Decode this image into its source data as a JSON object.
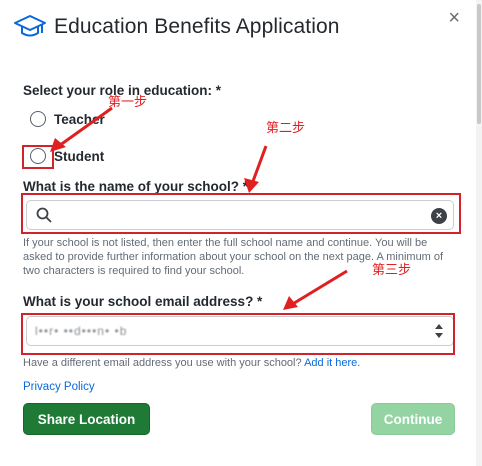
{
  "dialog": {
    "title": "Education Benefits Application",
    "close_glyph": "×",
    "icon": "graduation-cap-icon"
  },
  "role": {
    "label": "Select your role in education: *",
    "options": [
      "Teacher",
      "Student"
    ]
  },
  "school": {
    "label": "What is the name of your school? *",
    "value": "",
    "help": "If your school is not listed, then enter the full school name and continue. You will be asked to provide further information about your school on the next page. A minimum of two characters is required to find your school."
  },
  "email": {
    "label": "What is your school email address? *",
    "value": "l••r• ••d•••n• •b",
    "help_prefix": "Have a different email address you use with your school?",
    "help_link": "Add it here."
  },
  "footer": {
    "privacy": "Privacy Policy",
    "share_button": "Share Location",
    "continue_button": "Continue"
  },
  "annotations": {
    "step1": "第一步",
    "step2": "第二步",
    "step3": "第三步"
  },
  "colors": {
    "brand_blue": "#0969da",
    "primary_green": "#1f7a36",
    "disabled_green": "#94d3a2",
    "annotation_red": "#e02020"
  }
}
